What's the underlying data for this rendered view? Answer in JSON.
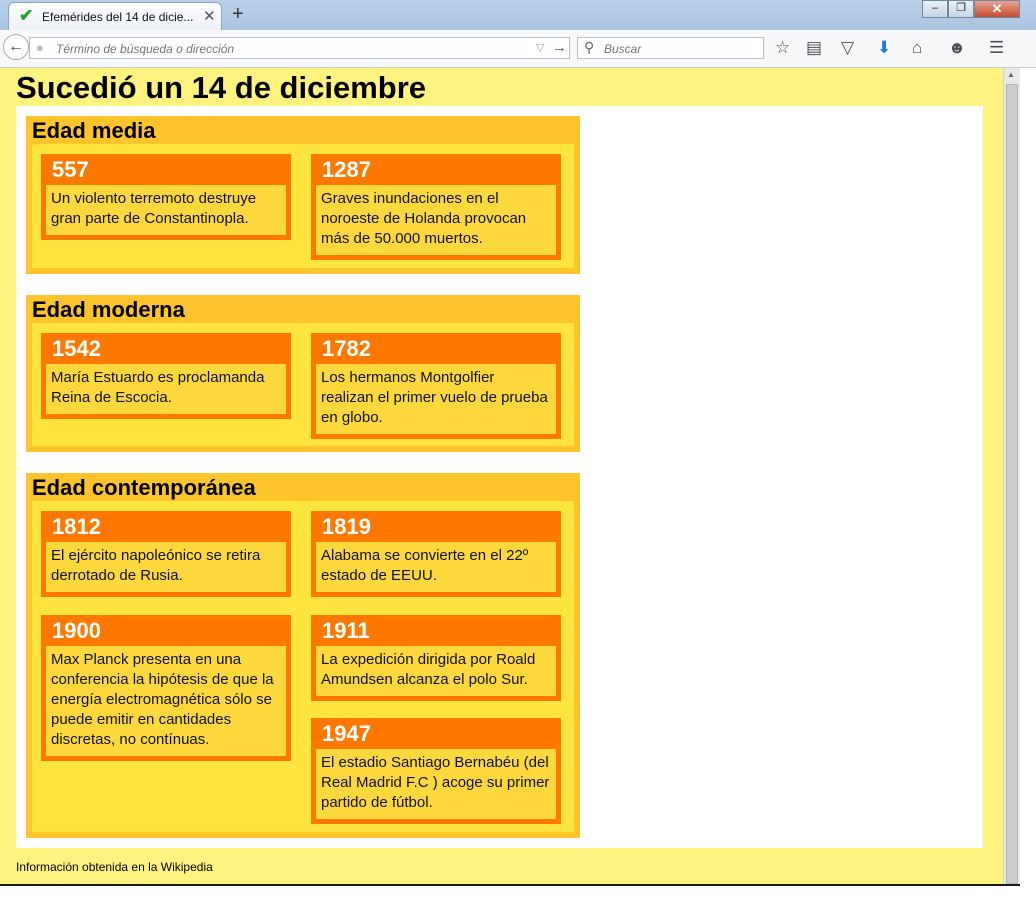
{
  "browser": {
    "tab_title": "Efemérides del 14 de dicie...",
    "tab_close": "✕",
    "new_tab": "+",
    "url_placeholder": "Término de búsqueda o dirección",
    "search_placeholder": "Buscar",
    "window_buttons": {
      "minimize": "–",
      "maximize": "❐",
      "close": "✕"
    },
    "icons": [
      "back-arrow-icon",
      "globe-icon",
      "dropdown-icon",
      "go-arrow-icon",
      "search-icon",
      "bookmark-star-icon",
      "reading-list-icon",
      "pocket-icon",
      "download-icon",
      "home-icon",
      "chat-icon",
      "hamburger-menu-icon"
    ],
    "accent_color": "#1aa12a"
  },
  "page": {
    "title": "Sucedió un 14 de diciembre",
    "footer": "Información obtenida en la Wikipedia",
    "colors": {
      "background": "#fff380",
      "era": "#ffc32b",
      "era_body": "#fee43f",
      "card": "#ff7800",
      "card_text": "#fdd83d"
    },
    "eras": [
      {
        "title": "Edad media",
        "events": [
          {
            "year": "557",
            "text": "Un violento terremoto destruye gran parte de Constantinopla."
          },
          {
            "year": "1287",
            "text": "Graves inundaciones en el noroeste de Holanda provocan más de 50.000 muertos."
          }
        ]
      },
      {
        "title": "Edad moderna",
        "events": [
          {
            "year": "1542",
            "text": "María Estuardo es proclamanda Reina de Escocia."
          },
          {
            "year": "1782",
            "text": "Los hermanos Montgolfier realizan el primer vuelo de prueba en globo."
          }
        ]
      },
      {
        "title": "Edad contemporánea",
        "events": [
          {
            "year": "1812",
            "text": "El ejército napoleónico se retira derrotado de Rusia."
          },
          {
            "year": "1819",
            "text": "Alabama se convierte en el 22º estado de EEUU."
          },
          {
            "year": "1900",
            "text": "Max Planck presenta en una conferencia la hipótesis de que la energía electromagnética sólo se puede emitir en cantidades discretas, no contínuas."
          },
          {
            "year": "1911",
            "text": "La expedición dirigida por Roald Amundsen alcanza el polo Sur."
          },
          {
            "year": "1947",
            "text": "El estadio Santiago Bernabéu (del Real Madrid F.C ) acoge su primer partido de fútbol."
          }
        ]
      }
    ]
  }
}
